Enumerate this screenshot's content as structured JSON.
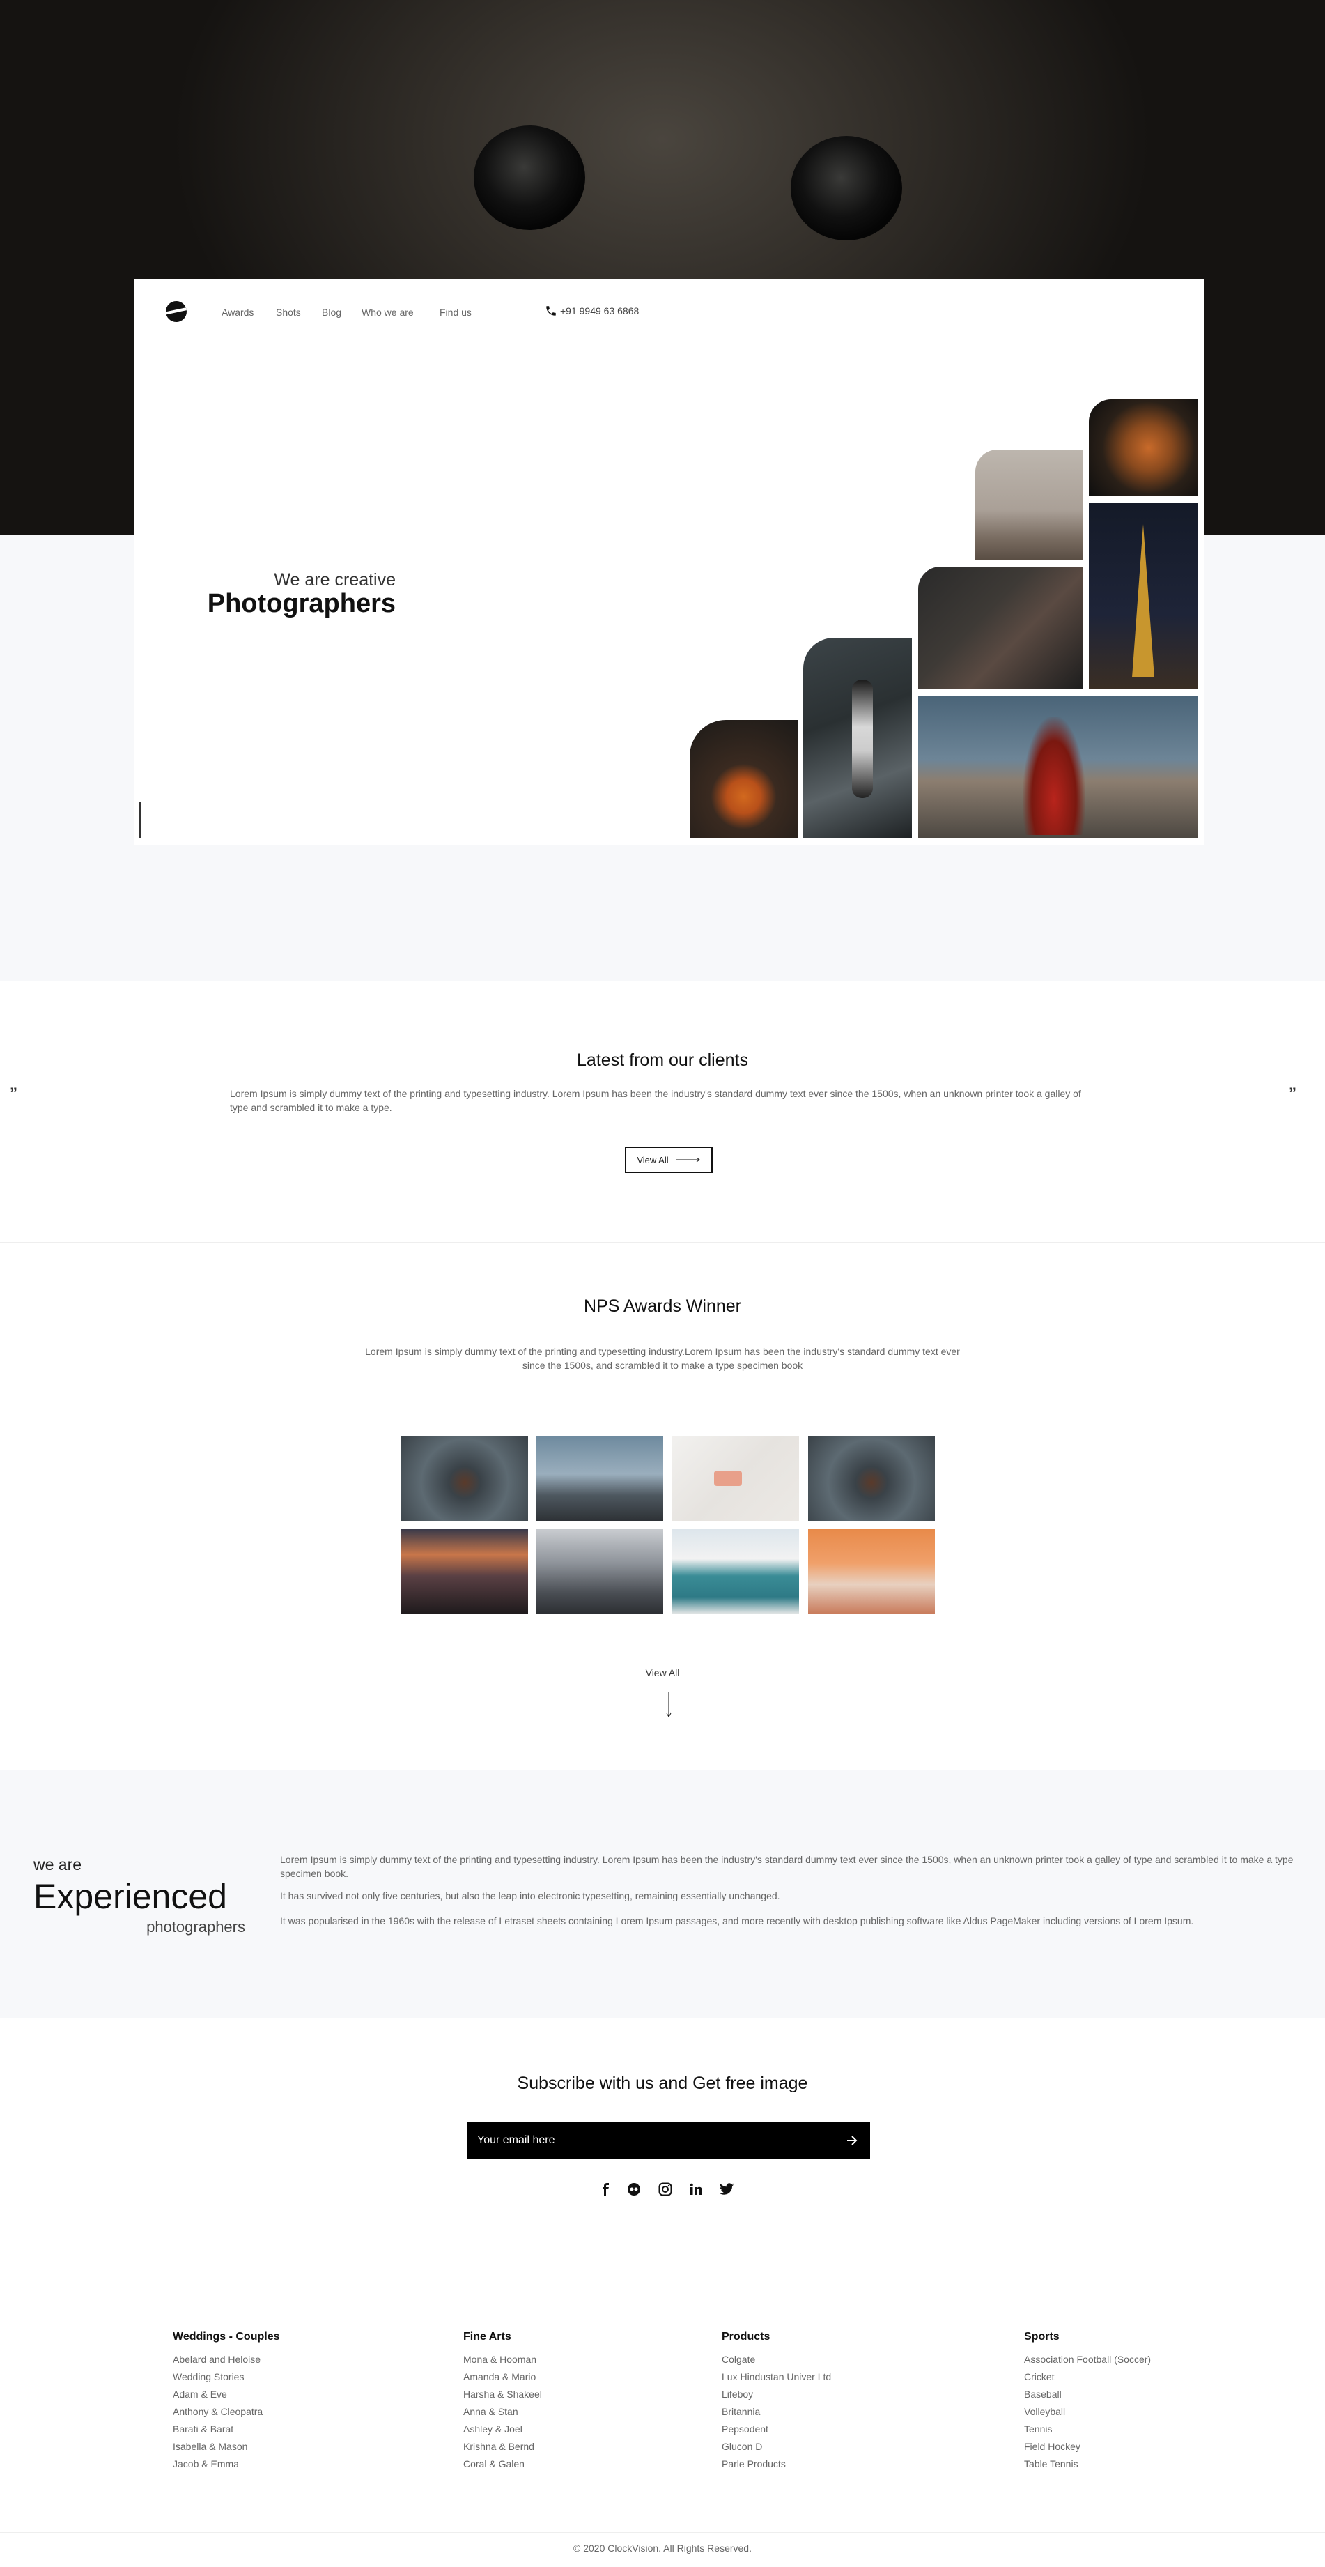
{
  "header": {
    "nav": [
      "Awards",
      "Shots",
      "Blog",
      "Who we are",
      "Find us"
    ],
    "phone": "+91 9949 63 6868"
  },
  "hero": {
    "tagline_small": "We are creative",
    "tagline_big": "Photographers"
  },
  "clients": {
    "title": "Latest from our clients",
    "text": "Lorem Ipsum is simply dummy text of the printing and typesetting industry. Lorem Ipsum has been the industry's standard dummy text ever since the 1500s, when an unknown printer took a galley of type and scrambled it to make a type.",
    "view_all": "View All",
    "quote_left": "”",
    "quote_right": "”"
  },
  "awards": {
    "title": "NPS Awards Winner",
    "text": "Lorem Ipsum is simply dummy text of the printing and typesetting industry.Lorem Ipsum has been the industry's standard dummy text ever since the 1500s, and scrambled it to make a type specimen book",
    "view_all": "View All"
  },
  "experience": {
    "we_are": "we are",
    "big": "Experienced",
    "small": "photographers",
    "p1": "Lorem Ipsum is simply dummy text of the printing and typesetting industry. Lorem Ipsum has been the industry's standard dummy text ever since the 1500s, when an unknown printer took a galley of type and scrambled it to make a type specimen book.",
    "p2": "It has survived not only five centuries, but also the leap into electronic typesetting, remaining essentially unchanged.",
    "p3": "It was popularised in the 1960s with the release of Letraset sheets containing Lorem Ipsum passages, and more recently with desktop publishing software like Aldus PageMaker including versions of Lorem Ipsum."
  },
  "subscribe": {
    "title": "Subscribe with us and Get free image",
    "placeholder": "Your email here",
    "social": [
      "facebook-icon",
      "flickr-icon",
      "instagram-icon",
      "linkedin-icon",
      "twitter-icon"
    ]
  },
  "footer": {
    "columns": [
      {
        "title": "Weddings - Couples",
        "items": [
          "Abelard and Heloise",
          "Wedding Stories",
          "Adam & Eve",
          "Anthony & Cleopatra",
          "Barati & Barat",
          "Isabella & Mason",
          "Jacob & Emma"
        ]
      },
      {
        "title": "Fine Arts",
        "items": [
          "Mona & Hooman",
          "Amanda & Mario",
          "Harsha & Shakeel",
          "Anna & Stan",
          "Ashley & Joel",
          "Krishna & Bernd",
          "Coral & Galen"
        ]
      },
      {
        "title": "Products",
        "items": [
          "Colgate",
          "Lux Hindustan Univer Ltd",
          "Lifeboy",
          "Britannia",
          "Pepsodent",
          "Glucon D",
          "Parle Products"
        ]
      },
      {
        "title": "Sports",
        "items": [
          "Association Football (Soccer)",
          "Cricket",
          "Baseball",
          "Volleyball",
          "Tennis",
          "Field Hockey",
          "Table Tennis"
        ]
      }
    ],
    "copyright": "© 2020 ClockVision. All Rights Reserved."
  }
}
